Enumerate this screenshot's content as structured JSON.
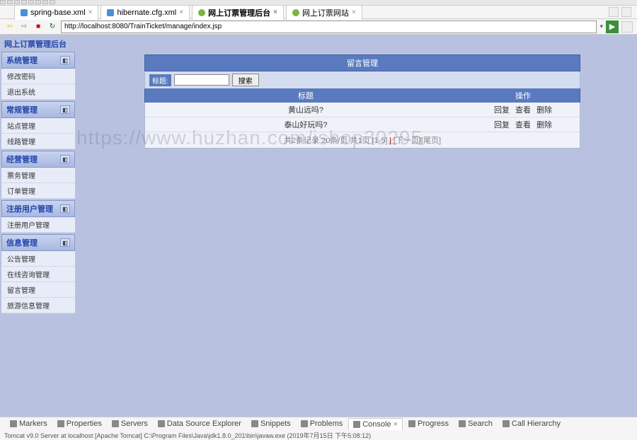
{
  "editor_tabs": [
    {
      "label": "spring-base.xml",
      "icon": "xml"
    },
    {
      "label": "hibernate.cfg.xml",
      "icon": "xml"
    },
    {
      "label": "网上订票管理后台",
      "icon": "web"
    },
    {
      "label": "网上订票网站",
      "icon": "web"
    }
  ],
  "address_bar": {
    "url": "http://localhost:8080/TrainTicket/manage/index.jsp"
  },
  "sidebar": {
    "title": "网上订票管理后台",
    "groups": [
      {
        "header": "系统管理",
        "items": [
          "修改密码",
          "退出系统"
        ]
      },
      {
        "header": "常规管理",
        "items": [
          "站点管理",
          "线路管理"
        ]
      },
      {
        "header": "经营管理",
        "items": [
          "票务管理",
          "订单管理"
        ]
      },
      {
        "header": "注册用户管理",
        "items": [
          "注册用户管理"
        ]
      },
      {
        "header": "信息管理",
        "items": [
          "公告管理",
          "在线咨询管理",
          "留言管理",
          "旅游信息管理"
        ]
      }
    ]
  },
  "panel": {
    "title": "留言管理",
    "search_label": "标题:",
    "search_btn": "搜索",
    "columns": {
      "title": "标题",
      "ops": "操作"
    },
    "rows": [
      {
        "title": "黄山远吗?",
        "ops": [
          "回复",
          "查看",
          "删除"
        ]
      },
      {
        "title": "泰山好玩吗?",
        "ops": [
          "回复",
          "查看",
          "删除"
        ]
      }
    ],
    "pager": {
      "text_prefix": "共2条记录 20条/页 共1页",
      "current": "[1-5]",
      "sep": "|",
      "last": "[下一页][尾页]"
    }
  },
  "watermark": "https://www.huzhan.com/ishop30295",
  "bottom_tabs": [
    "Markers",
    "Properties",
    "Servers",
    "Data Source Explorer",
    "Snippets",
    "Problems",
    "Console",
    "Progress",
    "Search",
    "Call Hierarchy"
  ],
  "bottom_active_index": 6,
  "status": "Tomcat v9.0 Server at localhost [Apache Tomcat] C:\\Program Files\\Java\\jdk1.8.0_201\\bin\\javaw.exe (2019年7月15日 下午5:08:12)"
}
